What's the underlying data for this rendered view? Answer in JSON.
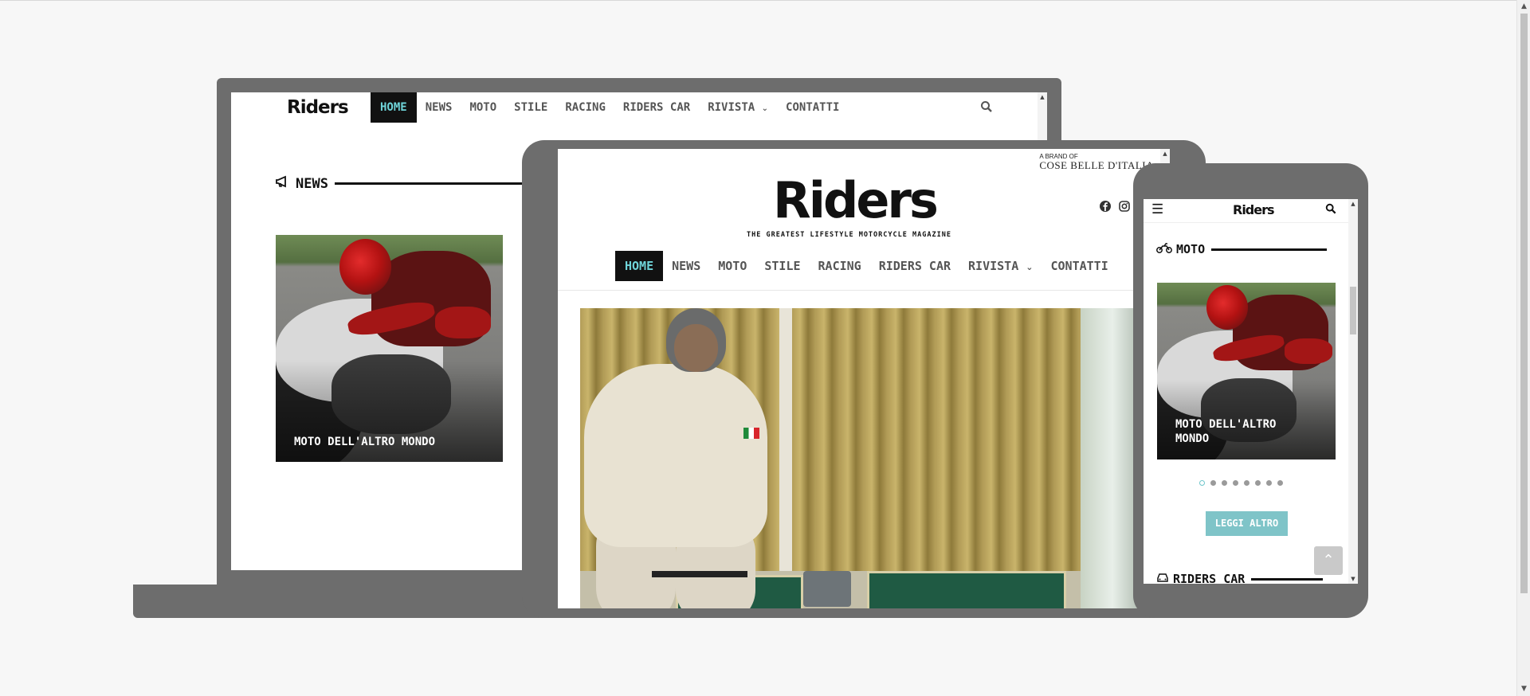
{
  "laptop": {
    "logo": "Riders",
    "nav": [
      "HOME",
      "NEWS",
      "MOTO",
      "STILE",
      "RACING",
      "RIDERS CAR",
      "RIVISTA",
      "CONTATTI"
    ],
    "section_title": "NEWS",
    "card_title": "MOTO DELL'ALTRO MONDO"
  },
  "tablet": {
    "brand_small": "A BRAND OF",
    "brand_name": "COSE BELLE D'ITALIA",
    "logo": "Riders",
    "tagline": "THE GREATEST LIFESTYLE MOTORCYCLE MAGAZINE",
    "nav": [
      "HOME",
      "NEWS",
      "MOTO",
      "STILE",
      "RACING",
      "RIDERS CAR",
      "RIVISTA",
      "CONTATTI"
    ]
  },
  "phone": {
    "logo": "Riders",
    "section_title": "MOTO",
    "card_title": "MOTO DELL'ALTRO MONDO",
    "dots_count": 8,
    "active_dot": 0,
    "read_more": "LEGGI ALTRO",
    "next_section": "RIDERS CAR"
  },
  "icons": {
    "search": "search-icon",
    "chevron": "chevron-down-icon",
    "megaphone": "megaphone-icon",
    "motorcycle": "motorcycle-icon",
    "car": "car-icon",
    "facebook": "facebook-icon",
    "instagram": "instagram-icon",
    "menu": "hamburger-menu-icon",
    "back_to_top": "chevron-up-icon"
  },
  "colors": {
    "accent": "#6fd4d9",
    "button": "#7fc4c8",
    "device_frame": "#6d6d6d"
  }
}
